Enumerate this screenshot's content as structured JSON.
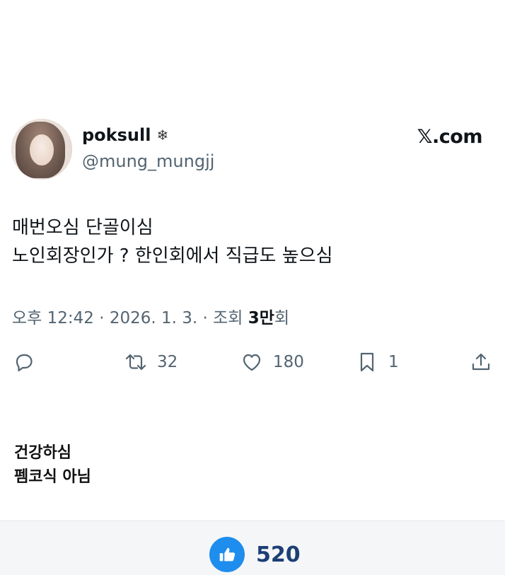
{
  "tweet": {
    "display_name": "poksull",
    "verified_icon": "flower-badge-icon",
    "handle": "@mung_mungjj",
    "source": "𝕏.com",
    "lines": [
      "매번오심 단골이심",
      "노인회장인가 ? 한인회에서 직급도 높으심"
    ],
    "meta_prefix": "오후 12:42 · 2026. 1. 3. · 조회 ",
    "views": "3만",
    "views_suffix": "회",
    "actions": {
      "reply_icon": "reply-icon",
      "retweet_count": "32",
      "like_count": "180",
      "bookmark_count": "1",
      "share_icon": "share-icon"
    }
  },
  "caption": {
    "line1": "건강하심",
    "line2": "펨코식 아님"
  },
  "reaction": {
    "icon": "thumbs-up-icon",
    "count": "520",
    "accent": "#1f8ded"
  }
}
